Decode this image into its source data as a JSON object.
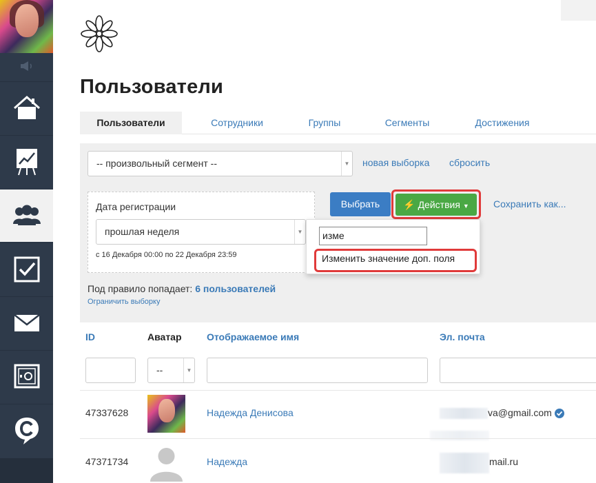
{
  "sidebar": {
    "items": [
      {
        "icon": "home-icon"
      },
      {
        "icon": "chart-board-icon"
      },
      {
        "icon": "users-icon",
        "active": true
      },
      {
        "icon": "checkbox-icon"
      },
      {
        "icon": "envelope-icon"
      },
      {
        "icon": "safe-icon"
      },
      {
        "icon": "c-chat-icon"
      }
    ]
  },
  "page": {
    "title": "Пользователи"
  },
  "tabs": [
    {
      "label": "Пользователи",
      "active": true
    },
    {
      "label": "Сотрудники"
    },
    {
      "label": "Группы"
    },
    {
      "label": "Сегменты"
    },
    {
      "label": "Достижения"
    }
  ],
  "filter": {
    "segment_value": "-- произвольный сегмент --",
    "new_selection_link": "новая выборка",
    "reset_link": "сбросить",
    "date_label": "Дата регистрации",
    "date_period_value": "прошлая неделя",
    "date_range_text": "с 16 Декабря 00:00 по 22 Декабря 23:59",
    "select_button": "Выбрать",
    "actions_button": "Действия",
    "save_as_link": "Сохранить как...",
    "rule_prefix": "Под правило попадает:",
    "rule_count": "6 пользователей",
    "limit_link": "Ограничить выборку"
  },
  "actions_dropdown": {
    "search_value": "изме",
    "items": [
      "Изменить значение доп. поля"
    ]
  },
  "table": {
    "headers": [
      "ID",
      "Аватар",
      "Отображаемое имя",
      "Эл. почта"
    ],
    "avatar_filter_value": "--",
    "rows": [
      {
        "id": "47337628",
        "name": "Надежда Денисова",
        "email_visible": "va@gmail.com"
      },
      {
        "id": "47371734",
        "name": "Надежда",
        "email_visible": "mail.ru"
      }
    ]
  },
  "colors": {
    "sidebar_bg": "#2e3a4a",
    "link_blue": "#3a7ab7",
    "primary_blue": "#3b7dc4",
    "action_green": "#4aa844",
    "highlight_red": "#e03a3a"
  }
}
